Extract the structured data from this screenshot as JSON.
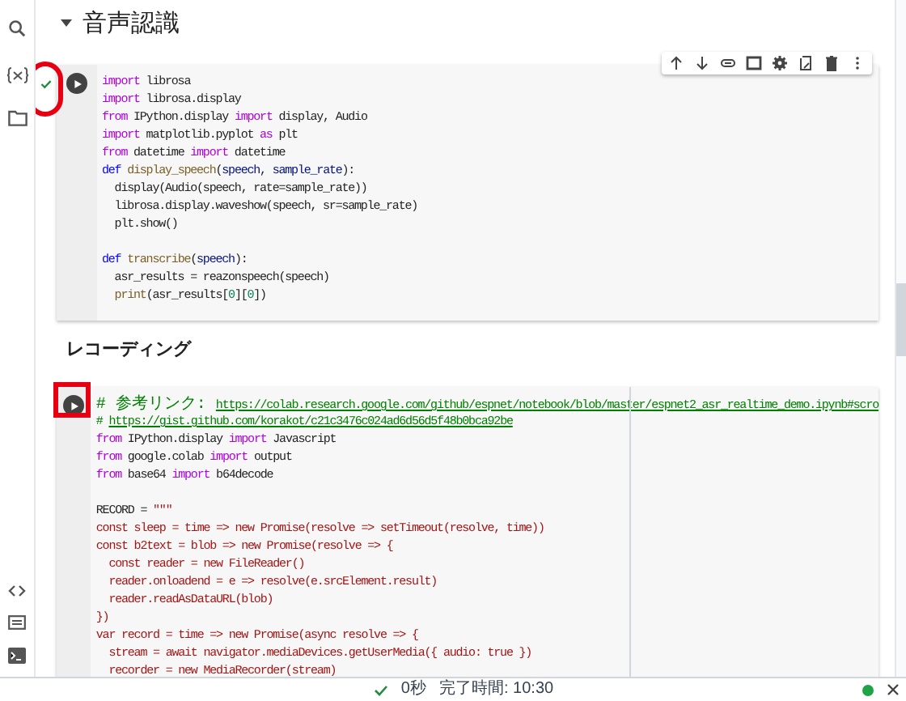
{
  "section": {
    "title": "音声認識",
    "expanded": true
  },
  "cells": [
    {
      "kind": "code",
      "executed": true,
      "lines": [
        {
          "kind": "code",
          "tokens": [
            {
              "kind": "kw",
              "text": "import"
            },
            {
              "kind": "plain",
              "text": " librosa"
            }
          ]
        },
        {
          "kind": "code",
          "tokens": [
            {
              "kind": "kw",
              "text": "import"
            },
            {
              "kind": "plain",
              "text": " librosa.display"
            }
          ]
        },
        {
          "kind": "code",
          "tokens": [
            {
              "kind": "kw",
              "text": "from"
            },
            {
              "kind": "plain",
              "text": " IPython.display "
            },
            {
              "kind": "kw",
              "text": "import"
            },
            {
              "kind": "plain",
              "text": " display, Audio"
            }
          ]
        },
        {
          "kind": "code",
          "tokens": [
            {
              "kind": "kw",
              "text": "import"
            },
            {
              "kind": "plain",
              "text": " matplotlib.pyplot "
            },
            {
              "kind": "kw",
              "text": "as"
            },
            {
              "kind": "plain",
              "text": " plt"
            }
          ]
        },
        {
          "kind": "code",
          "tokens": [
            {
              "kind": "kw",
              "text": "from"
            },
            {
              "kind": "plain",
              "text": " datetime "
            },
            {
              "kind": "kw",
              "text": "import"
            },
            {
              "kind": "plain",
              "text": " datetime"
            }
          ]
        },
        {
          "kind": "code",
          "tokens": [
            {
              "kind": "def",
              "text": "def "
            },
            {
              "kind": "fn",
              "text": "display_speech"
            },
            {
              "kind": "plain",
              "text": "("
            },
            {
              "kind": "var",
              "text": "speech"
            },
            {
              "kind": "plain",
              "text": ", "
            },
            {
              "kind": "var",
              "text": "sample_rate"
            },
            {
              "kind": "plain",
              "text": "):"
            }
          ]
        },
        {
          "kind": "code",
          "tokens": [
            {
              "kind": "plain",
              "text": "  display(Audio(speech, rate=sample_rate))"
            }
          ]
        },
        {
          "kind": "code",
          "tokens": [
            {
              "kind": "plain",
              "text": "  librosa.display.waveshow(speech, sr=sample_rate)"
            }
          ]
        },
        {
          "kind": "code",
          "tokens": [
            {
              "kind": "plain",
              "text": "  plt.show()"
            }
          ]
        },
        {
          "kind": "blank"
        },
        {
          "kind": "code",
          "tokens": [
            {
              "kind": "def",
              "text": "def "
            },
            {
              "kind": "fn",
              "text": "transcribe"
            },
            {
              "kind": "plain",
              "text": "("
            },
            {
              "kind": "var",
              "text": "speech"
            },
            {
              "kind": "plain",
              "text": "):"
            }
          ]
        },
        {
          "kind": "code",
          "tokens": [
            {
              "kind": "plain",
              "text": "  asr_results = reazonspeech(speech)"
            }
          ]
        },
        {
          "kind": "code",
          "tokens": [
            {
              "kind": "fn",
              "text": "  print"
            },
            {
              "kind": "plain",
              "text": "(asr_results["
            },
            {
              "kind": "num",
              "text": "0"
            },
            {
              "kind": "plain",
              "text": "]["
            },
            {
              "kind": "num",
              "text": "0"
            },
            {
              "kind": "plain",
              "text": "])"
            }
          ]
        }
      ]
    },
    {
      "kind": "text",
      "heading": "レコーディング"
    },
    {
      "kind": "code",
      "executed": false,
      "lines": [
        {
          "kind": "code",
          "tokens": [
            {
              "kind": "cjk",
              "text": "# 参考リンク: "
            },
            {
              "kind": "link",
              "text": "https://colab.research.google.com/github/espnet/notebook/blob/master/espnet2_asr_realtime_demo.ipynb#scro"
            }
          ]
        },
        {
          "kind": "code",
          "tokens": [
            {
              "kind": "com",
              "text": "# "
            },
            {
              "kind": "link",
              "text": "https://gist.github.com/korakot/c21c3476c024ad6d56d5f48b0bca92be"
            }
          ]
        },
        {
          "kind": "code",
          "tokens": [
            {
              "kind": "kw",
              "text": "from"
            },
            {
              "kind": "plain",
              "text": " IPython.display "
            },
            {
              "kind": "kw",
              "text": "import"
            },
            {
              "kind": "plain",
              "text": " Javascript"
            }
          ]
        },
        {
          "kind": "code",
          "tokens": [
            {
              "kind": "kw",
              "text": "from"
            },
            {
              "kind": "plain",
              "text": " google.colab "
            },
            {
              "kind": "kw",
              "text": "import"
            },
            {
              "kind": "plain",
              "text": " output"
            }
          ]
        },
        {
          "kind": "code",
          "tokens": [
            {
              "kind": "kw",
              "text": "from"
            },
            {
              "kind": "plain",
              "text": " base64 "
            },
            {
              "kind": "kw",
              "text": "import"
            },
            {
              "kind": "plain",
              "text": " b64decode"
            }
          ]
        },
        {
          "kind": "blank"
        },
        {
          "kind": "code",
          "tokens": [
            {
              "kind": "plain",
              "text": "RECORD = "
            },
            {
              "kind": "str",
              "text": "\"\"\""
            }
          ]
        },
        {
          "kind": "code",
          "tokens": [
            {
              "kind": "str",
              "text": "const sleep = time => new Promise(resolve => setTimeout(resolve, time))"
            }
          ]
        },
        {
          "kind": "code",
          "tokens": [
            {
              "kind": "str",
              "text": "const b2text = blob => new Promise(resolve => {"
            }
          ]
        },
        {
          "kind": "code",
          "tokens": [
            {
              "kind": "str",
              "text": "  const reader = new FileReader()"
            }
          ]
        },
        {
          "kind": "code",
          "tokens": [
            {
              "kind": "str",
              "text": "  reader.onloadend = e => resolve(e.srcElement.result)"
            }
          ]
        },
        {
          "kind": "code",
          "tokens": [
            {
              "kind": "str",
              "text": "  reader.readAsDataURL(blob)"
            }
          ]
        },
        {
          "kind": "code",
          "tokens": [
            {
              "kind": "str",
              "text": "})"
            }
          ]
        },
        {
          "kind": "code",
          "tokens": [
            {
              "kind": "str",
              "text": "var record = time => new Promise(async resolve => {"
            }
          ]
        },
        {
          "kind": "code",
          "tokens": [
            {
              "kind": "str",
              "text": "  stream = await navigator.mediaDevices.getUserMedia({ audio: true })"
            }
          ]
        },
        {
          "kind": "code",
          "tokens": [
            {
              "kind": "str",
              "text": "  recorder = new MediaRecorder(stream)"
            }
          ]
        }
      ]
    }
  ],
  "status_bar": {
    "duration": "0秒",
    "completed": "完了時間: 10:30",
    "connected": true
  }
}
